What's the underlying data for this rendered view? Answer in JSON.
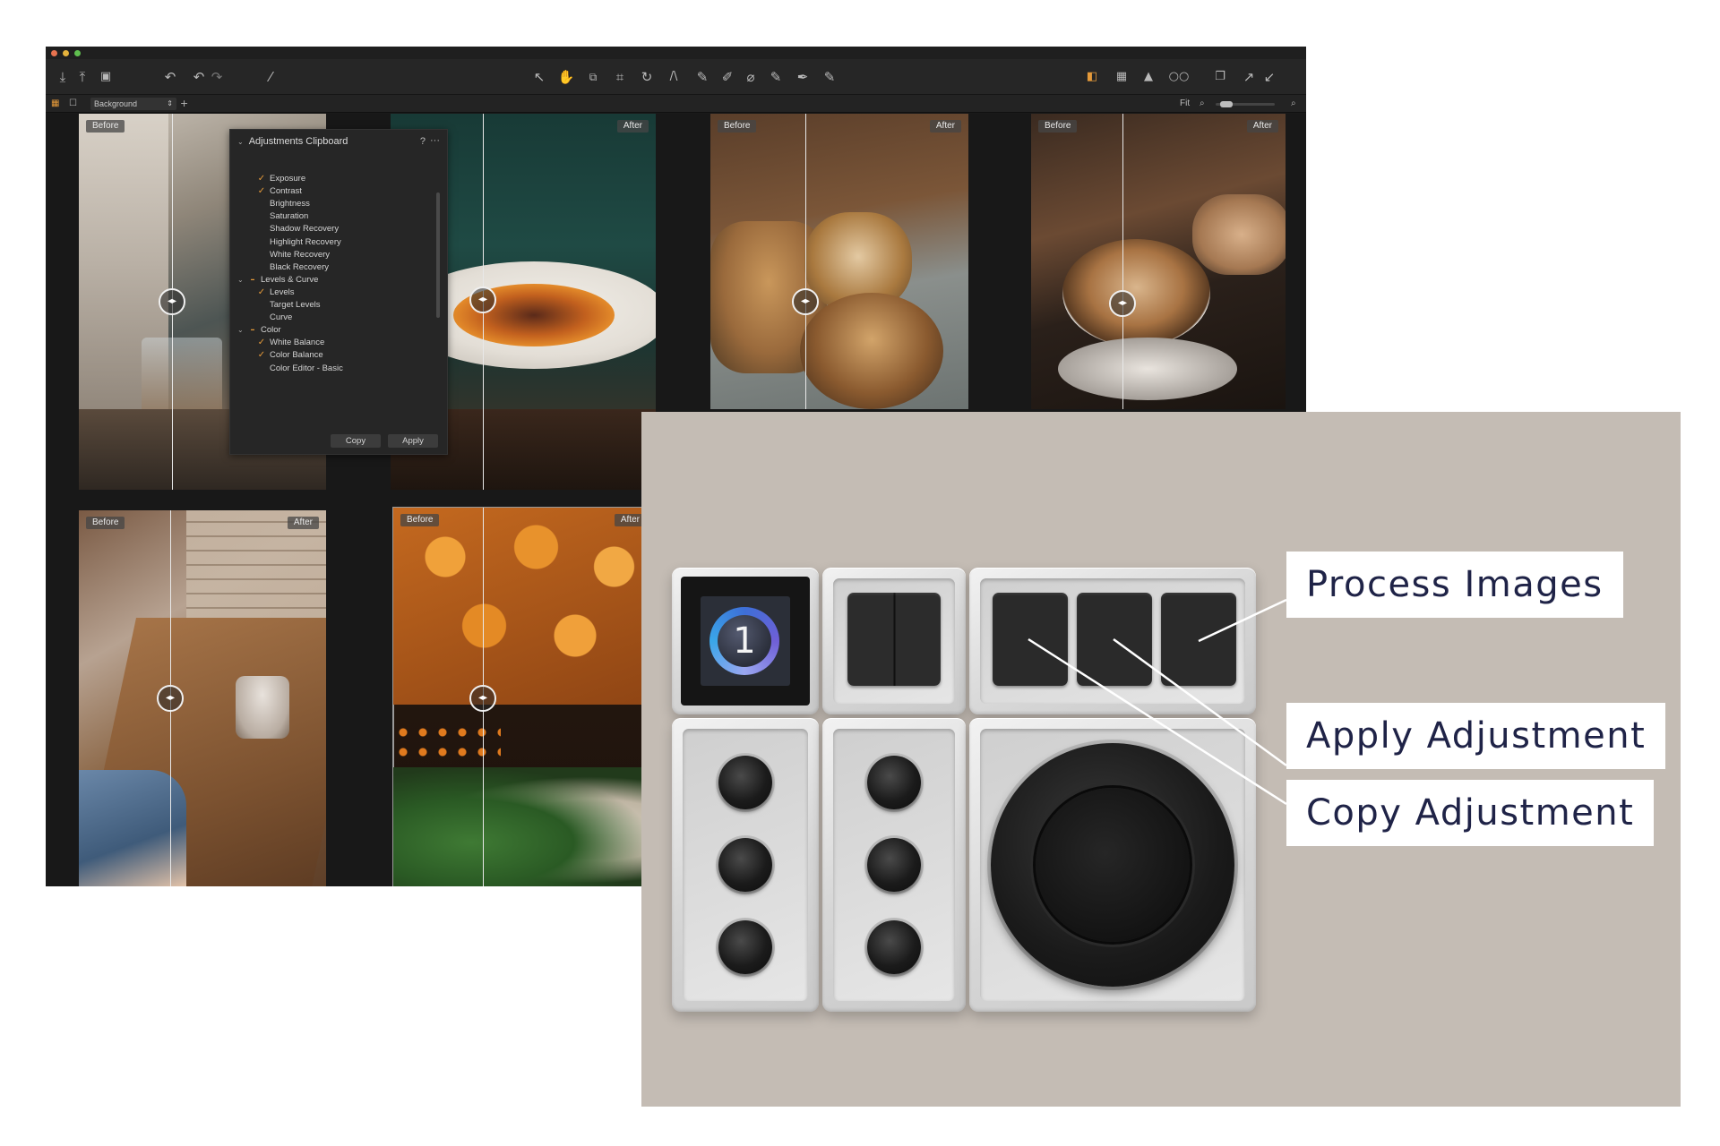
{
  "toolbar": {
    "left_icons": [
      "import-icon",
      "export-icon",
      "camera-icon",
      "undo-history-icon",
      "undo-icon",
      "redo-icon",
      "magic-wand-icon"
    ],
    "cursor_tools": [
      "select-cursor-icon",
      "pan-hand-icon",
      "crop-mask-icon",
      "crop-icon",
      "rotate-icon",
      "keystone-icon",
      "brush-icon",
      "eraser-icon",
      "gradient-icon",
      "spot-heal-icon",
      "picker-icon",
      "annotate-icon"
    ],
    "right_icons": [
      "compare-view-icon",
      "grid-view-icon",
      "exposure-warning-icon",
      "proof-glasses-icon",
      "windows-icon",
      "expand-icon",
      "collapse-icon"
    ],
    "active_icon": "pan-hand-icon",
    "accent_color": "#e59a3a"
  },
  "subbar": {
    "style_value": "Background",
    "fit_label": "Fit",
    "zoom_fraction": 0.1
  },
  "labels": {
    "before": "Before",
    "after": "After"
  },
  "clipboard": {
    "title": "Adjustments Clipboard",
    "help": "?",
    "more": "···",
    "items": [
      {
        "label": "Exposure",
        "checked": true
      },
      {
        "label": "Contrast",
        "checked": true
      },
      {
        "label": "Brightness",
        "checked": false
      },
      {
        "label": "Saturation",
        "checked": false
      },
      {
        "label": "Shadow Recovery",
        "checked": false
      },
      {
        "label": "Highlight Recovery",
        "checked": false
      },
      {
        "label": "White Recovery",
        "checked": false
      },
      {
        "label": "Black Recovery",
        "checked": false
      },
      {
        "label": "Levels & Curve",
        "group": true,
        "partial": true
      },
      {
        "label": "Levels",
        "checked": true
      },
      {
        "label": "Target Levels",
        "checked": false
      },
      {
        "label": "Curve",
        "checked": false
      },
      {
        "label": "Color",
        "group": true,
        "partial": true
      },
      {
        "label": "White Balance",
        "checked": true
      },
      {
        "label": "Color Balance",
        "checked": true
      },
      {
        "label": "Color Editor - Basic",
        "checked": false
      }
    ],
    "copy_button": "Copy",
    "apply_button": "Apply"
  },
  "console": {
    "logo_digit": "1",
    "callouts": {
      "process": "Process Images",
      "apply": "Apply Adjustment",
      "copy": "Copy Adjustment"
    },
    "background_color": "#c4bcb4",
    "label_text_color": "#1f2347"
  }
}
